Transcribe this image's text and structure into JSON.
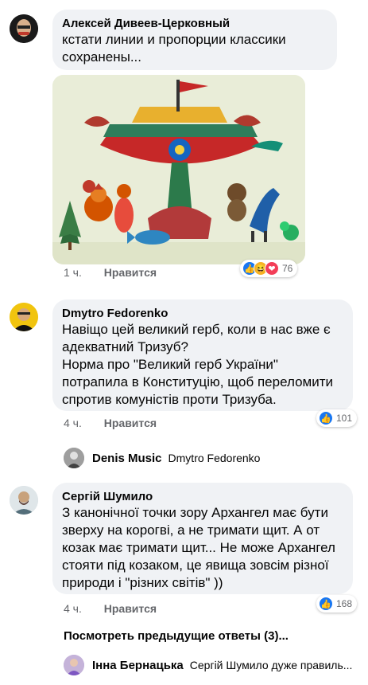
{
  "comments": [
    {
      "author": "Алексей Дивеев-Церковный",
      "text": "кстати линии и пропорции классики сохранены...",
      "time": "1 ч.",
      "like_label": "Нравится",
      "reaction_count": "76"
    },
    {
      "author": "Dmytro Fedorenko",
      "text": "Навіщо цей великий герб, коли в нас вже є адекватний Тризуб?\nНорма про \"Великий герб України\" потрапила в Конституцію, щоб переломити спротив комуністів проти Тризуба.",
      "time": "4 ч.",
      "like_label": "Нравится",
      "reaction_count": "101"
    },
    {
      "author": "Сергій Шумило",
      "text": "З канонічної точки зору Архангел має бути зверху на корогві, а не тримати щит. А от козак має тримати щит... Не може Архангел стояти під козаком, це явища зовсім різної природи і \"різних світів\" ))",
      "time": "4 ч.",
      "like_label": "Нравится",
      "reaction_count": "168"
    }
  ],
  "replies": [
    {
      "author": "Denis Music",
      "text": "Dmytro Fedorenko"
    },
    {
      "author": "Інна Бернацька",
      "text": "Сергій Шумило дуже правиль..."
    }
  ],
  "more_replies_label": "Посмотреть предыдущие ответы (3)...",
  "colors": {
    "bubble": "#f0f2f5",
    "like_blue": "#1877f2",
    "love_red": "#f33e58",
    "haha_yellow": "#f7b125"
  }
}
